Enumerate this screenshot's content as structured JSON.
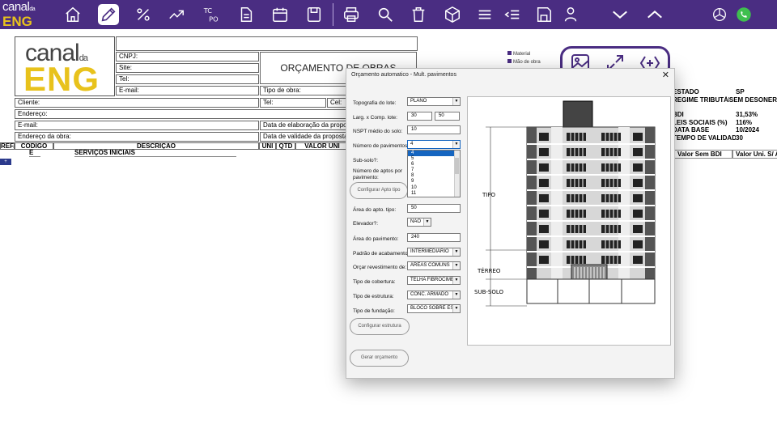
{
  "ribbon": {
    "brand_line1": "canal",
    "brand_da": "da",
    "brand_line2": "ENG",
    "icons": [
      "home-icon",
      "pencil-icon",
      "percent-icon",
      "trend-up-icon",
      "tc-po-icon",
      "document-icon",
      "calendar-icon",
      "save-icon",
      "printer-icon",
      "search-icon",
      "trash-icon",
      "cube-icon",
      "list-icon",
      "list-indent-icon",
      "floppy-icon",
      "user-icon",
      "chevron-down-icon",
      "chevron-up-icon",
      "openai-icon",
      "whatsapp-icon"
    ],
    "tc_po_text": "TC\nPO"
  },
  "sheet": {
    "logo_line1": "canal",
    "logo_da": "da",
    "logo_line2": "ENG",
    "cnpj": "CNPJ:",
    "site": "Site:",
    "tel": "Tel:",
    "email": "E-mail:",
    "title": "ORÇAMENTO DE OBRAS",
    "tipo_obra": "Tipo de obra:",
    "cliente": "Cliente:",
    "tel2": "Tel:",
    "cel": "Cel:",
    "endereco": "Endereço:",
    "email2": "E-mail:",
    "data_elaboracao": "Data de elaboração da proposta:",
    "endereco_obra": "Endereço da obra:",
    "data_validade": "Data de validade da proposta:",
    "col_ref": "REF.",
    "col_codigo": "CÓDIGO",
    "col_descricao": "DESCRIÇÃO",
    "col_uni": "UNI",
    "col_qtd": "QTD",
    "col_valor_uni": "VALOR UNI",
    "row_e": "E",
    "row_servicos": "SERVIÇOS INICIAIS",
    "col_valor_sem_bdi": "Valor Sem BDI",
    "col_valor_uni_s": "Valor Uni. S/ A",
    "blue_mark": "+",
    "legend": [
      "Material",
      "Mão de obra"
    ]
  },
  "side_info": [
    {
      "k": "ESTADO",
      "v": "SP"
    },
    {
      "k": "REGIME TRIBUTÁRIO",
      "v": "SEM DESONER"
    },
    {
      "k": "",
      "v": ""
    },
    {
      "k": "BDI",
      "v": "31,53%"
    },
    {
      "k": "LEIS SOCIAIS (%)",
      "v": "116%"
    },
    {
      "k": "DATA BASE",
      "v": "10/2024"
    },
    {
      "k": "TEMPO DE VALIDADE",
      "v": "30"
    }
  ],
  "dialog": {
    "title": "Orçamento automatico - Mult. pavimentos",
    "close": "✕",
    "topografia_label": "Topografia do lote:",
    "topografia_value": "PLANO",
    "larg_label": "Larg. x Comp. lote:",
    "larg_value": "30",
    "comp_value": "50",
    "nspt_label": "NSPT médio do solo:",
    "nspt_value": "10",
    "num_pav_label": "Número de pavimentos:",
    "num_pav_value": "4",
    "subsolo_label": "Sub-solo?:",
    "num_aptos_label": "Número de aptos por pavimento:",
    "configurar_apto": "Configurar Apto tipo",
    "dropdown_options": [
      "4",
      "5",
      "6",
      "7",
      "8",
      "9",
      "10",
      "11"
    ],
    "area_apto_label": "Área do apto. tipo:",
    "area_apto_value": "50",
    "elevador_label": "Elevador?:",
    "elevador_value": "NÃO",
    "area_pav_label": "Área do pavimento:",
    "area_pav_value": "240",
    "padrao_label": "Padrão de acabamento:",
    "padrao_value": "INTERMEDIÁRIO",
    "orcar_label": "Orçar revestimento de:",
    "orcar_value": "ÁREAS COMUNS",
    "cobertura_label": "Tipo de cobertura:",
    "cobertura_value": "TELHA FIBROCIME",
    "estrutura_label": "Tipo de estrutura:",
    "estrutura_value": "CONC. ARMADO",
    "fundacao_label": "Tipo de fundação:",
    "fundacao_value": "BLOCO SOBRE EST",
    "configurar_estrutura": "Configurar estrutura",
    "gerar_orcamento": "Gerar orçamento"
  },
  "drawing": {
    "label_tipo": "TIPO",
    "label_terreo": "TÉRREO",
    "label_subsolo": "SUB-SOLO"
  }
}
